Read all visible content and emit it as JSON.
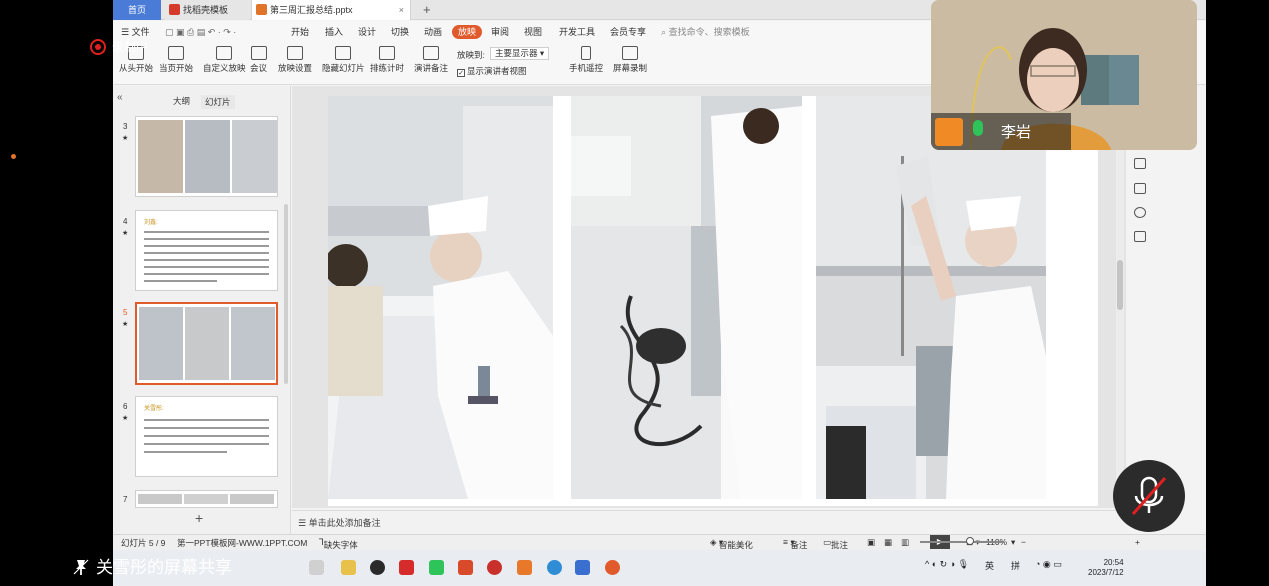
{
  "tabs": [
    {
      "label": "首页",
      "icon": "home-icon"
    },
    {
      "label": "找稻壳模板",
      "icon": "docer-icon"
    },
    {
      "label": "第三周汇报总结.pptx",
      "icon": "pptx-file-icon"
    }
  ],
  "menu": {
    "file": "文件",
    "items": [
      "开始",
      "插入",
      "设计",
      "切换",
      "动画",
      "放映",
      "审阅",
      "视图",
      "开发工具",
      "会员专享"
    ],
    "active": "放映",
    "search_placeholder": "查找命令、搜索模板"
  },
  "ribbon": {
    "buttons": [
      "从头开始",
      "当页开始",
      "自定义放映",
      "会议",
      "放映设置",
      "隐藏幻灯片",
      "排练计时",
      "演讲备注",
      "手机遥控",
      "屏幕录制"
    ],
    "projector_label": "放映到:",
    "projector_value": "主要显示器",
    "presenter_view_label": "显示演讲者视图"
  },
  "leftpane": {
    "tab_outline": "大纲",
    "tab_slides": "幻灯片",
    "slides": [
      {
        "num": "3",
        "type": "photos"
      },
      {
        "num": "4",
        "type": "text",
        "title": "刘鑫:"
      },
      {
        "num": "5",
        "type": "photos",
        "selected": true
      },
      {
        "num": "6",
        "type": "text",
        "title": "关雪彤:"
      },
      {
        "num": "7",
        "type": "photos"
      }
    ]
  },
  "notes_placeholder": "单击此处添加备注",
  "status": {
    "slide_counter": "幻灯片 5 / 9",
    "theme": "第一PPT模板网-WWW.1PPT.COM",
    "missing_font": "缺失字体",
    "smart_beautify": "智能美化",
    "notes": "备注",
    "comments": "批注",
    "zoom": "110%",
    "zoom_level_percent": 110
  },
  "taskbar": {
    "tray_lang1": "英",
    "tray_lang2": "拼",
    "time": "20:54",
    "date": "2023/7/12"
  },
  "overlay": {
    "recording_label": "录制中",
    "participant_name": "李岩",
    "share_label": "关雪彤的屏幕共享"
  },
  "colors": {
    "accent_orange": "#e05a2b",
    "tab_blue": "#4a7bd6",
    "record_red": "#e02020",
    "mic_green": "#2ec45a"
  }
}
